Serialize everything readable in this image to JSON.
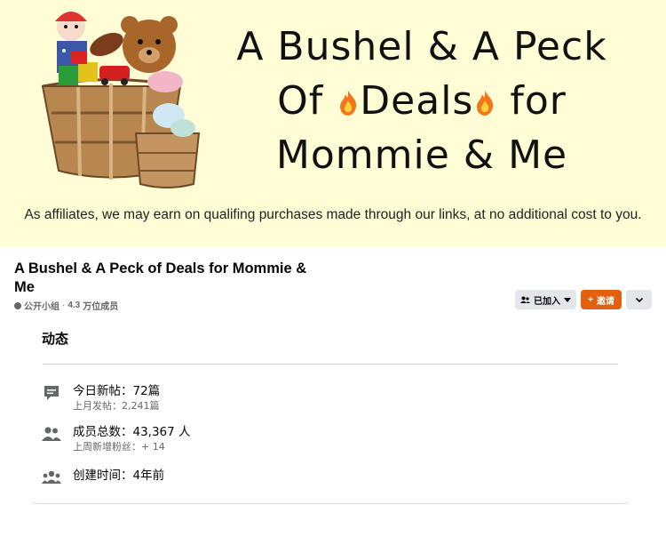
{
  "cover": {
    "title_lines": [
      "A Bushel & A Peck",
      "Of",
      "Deals",
      "for",
      "Mommie & Me"
    ],
    "disclaimer": "As affiliates, we may earn on qualifing purchases made through our links, at no additional cost to you."
  },
  "group": {
    "name": "A Bushel & A Peck of Deals for Mommie & Me",
    "privacy": "公开小组",
    "separator": "·",
    "members_count": "4.3",
    "members_unit": "万位成员"
  },
  "actions": {
    "joined_label": "已加入",
    "invite_label": "邀请",
    "invite_prefix": "+"
  },
  "about": {
    "title": "动态",
    "stats": [
      {
        "icon": "chat-bubble-icon",
        "primary": "今日新帖：72篇",
        "secondary": "上月发帖：2,241篇"
      },
      {
        "icon": "members-icon",
        "primary": "成员总数：43,367 人",
        "secondary": "上周新增粉丝：+ 14"
      },
      {
        "icon": "group-people-icon",
        "primary": "创建时间：4年前",
        "secondary": ""
      }
    ]
  },
  "colors": {
    "cover_bg": "#fffdd6",
    "invite_orange": "#e4600f",
    "secondary_text": "#65676b",
    "button_gray": "#e4e6eb"
  }
}
